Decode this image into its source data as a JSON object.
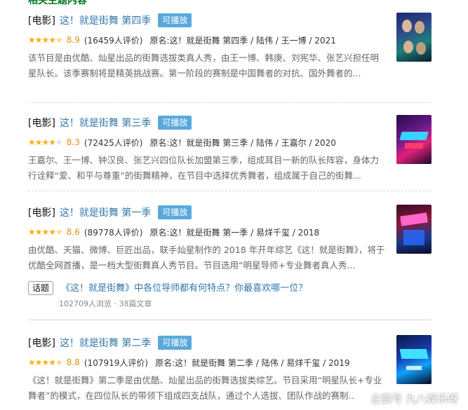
{
  "section_header": "相关主题内容",
  "items": [
    {
      "category": "[电影]",
      "title": "这！就是街舞 第四季",
      "playable": "可播放",
      "stars": 4.5,
      "score": "8.9",
      "count": "(16459人评价)",
      "meta": "原名:这！就是街舞 第四季 / 陆伟 / 王一博 / 2021",
      "desc": "该节目是由优酷、灿星出品的街舞选拔类真人秀，由王一博、韩庚、刘宪华、张艺兴担任明星队长。该季赛制将是精英挑战赛。第一阶段的赛制是中国舞者的对抗、国外舞者的..."
    },
    {
      "category": "[电影]",
      "title": "这！就是街舞 第三季",
      "playable": "可播放",
      "stars": 4,
      "score": "8.3",
      "count": "(72425人评价)",
      "meta": "原名:这！就是街舞 第三季 / 陆伟 / 王嘉尔 / 2020",
      "desc": "王嘉尔、王一博、钟汉良、张艺兴四位队长加盟第三季，组成耳目一新的队长阵容，身体力行诠释“爱、和平与尊重”的街舞精神，在节目中选择优秀舞者，组成属于自己的街舞..."
    },
    {
      "category": "[电影]",
      "title": "这！就是街舞 第一季",
      "playable": "可播放",
      "stars": 4.5,
      "score": "8.6",
      "count": "(89778人评价)",
      "meta": "原名:这！就是街舞 第一季 / 易烊千玺 / 2018",
      "desc": "由优酷、天猫、微博、巨匠出品，联手灿星制作的 2018 年开年综艺《这！就是街舞》，将于优酷全网首播，是一档大型街舞真人秀节目。节目选用“明星导师+专业舞者真人秀..."
    },
    {
      "category": "[电影]",
      "title": "这！就是街舞 第二季",
      "playable": "可播放",
      "stars": 4.5,
      "score": "8.8",
      "count": "(107919人评价)",
      "meta": "原名:这！就是街舞 第二季 / 陆伟 / 易烊千玺 / 2019",
      "desc": "《这！就是街舞》第二季是由优酷、灿星出品的街舞选拔类综艺。节目采用“明星队长+专业舞者”的模式，在四位队长的带领下组成四支战队，通过个人选拔、团队作战的赛制..."
    }
  ],
  "topic": {
    "tag": "话题",
    "link": "《这！就是街舞》中各位导师都有何特点？你最喜欢哪一位？",
    "stats": "102709人浏览 · 38篇文章"
  },
  "watermark": "企鹅号 九八娱乐呀",
  "colors": {
    "link": "#3377aa",
    "badge": "#5aa9dc",
    "star": "#f5b10f",
    "score": "#e09015"
  }
}
